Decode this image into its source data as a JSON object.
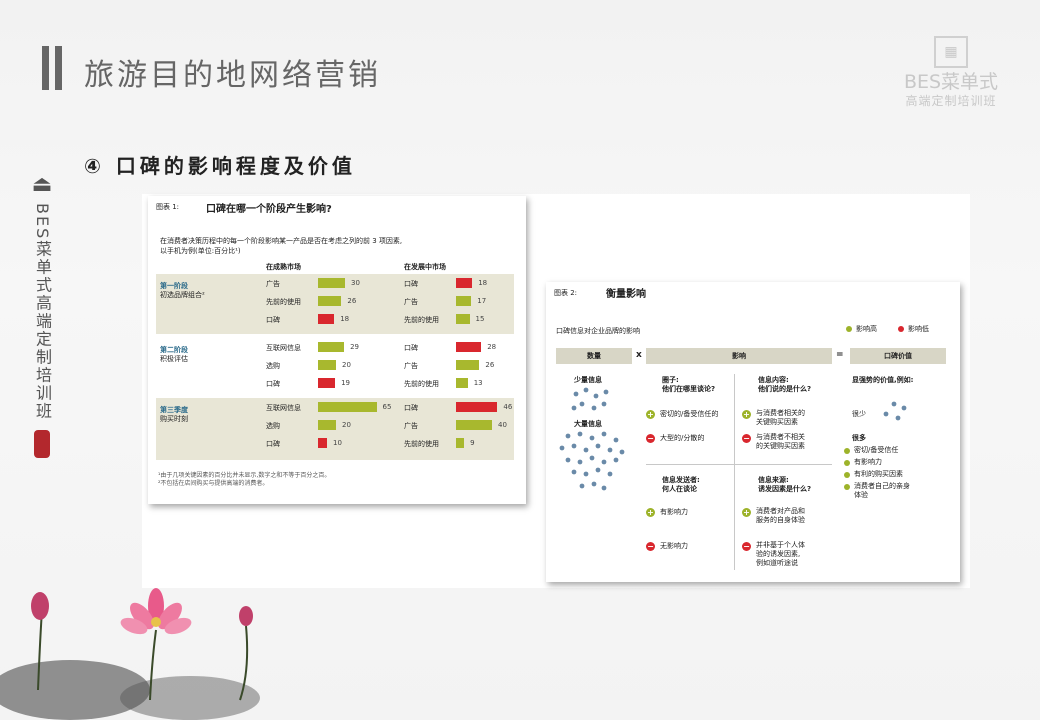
{
  "header": {
    "title": "旅游目的地网络营销",
    "subtitle": "④ 口碑的影响程度及价值"
  },
  "logo": {
    "line1": "BES菜单式",
    "line2": "高端定制培训班"
  },
  "side": {
    "text": "BES菜单式高端定制培训班"
  },
  "chart1": {
    "label": "图表 1:",
    "title": "口碑在哪一个阶段产生影响?",
    "desc1": "在消费者决策历程中的每一个阶段影响某一产品是否在考虑之列的前 3 项因素,",
    "desc2": "以手机为例(单位:百分比¹)",
    "col_mature": "在成熟市场",
    "col_developing": "在发展中市场",
    "footnote1": "¹由于几项关键因素的百分比并未显示,数字之和不等于百分之百。",
    "footnote2": "²不包括在店间购买与提供高端的消费者。"
  },
  "chart_data": {
    "type": "bar",
    "stages": [
      {
        "name": "第一阶段",
        "desc": "初选品牌组合²",
        "mature": [
          {
            "label": "广告",
            "value": 30
          },
          {
            "label": "先前的使用",
            "value": 26
          },
          {
            "label": "口碑",
            "value": 18
          }
        ],
        "developing": [
          {
            "label": "口碑",
            "value": 18
          },
          {
            "label": "广告",
            "value": 17
          },
          {
            "label": "先前的使用",
            "value": 15
          }
        ]
      },
      {
        "name": "第二阶段",
        "desc": "积极评估",
        "mature": [
          {
            "label": "互联网信息",
            "value": 29
          },
          {
            "label": "选购",
            "value": 20
          },
          {
            "label": "口碑",
            "value": 19
          }
        ],
        "developing": [
          {
            "label": "口碑",
            "value": 28
          },
          {
            "label": "广告",
            "value": 26
          },
          {
            "label": "先前的使用",
            "value": 13
          }
        ]
      },
      {
        "name": "第三季度",
        "desc": "购买时刻",
        "mature": [
          {
            "label": "互联网信息",
            "value": 65
          },
          {
            "label": "选购",
            "value": 20
          },
          {
            "label": "口碑",
            "value": 10
          }
        ],
        "developing": [
          {
            "label": "口碑",
            "value": 46
          },
          {
            "label": "广告",
            "value": 40
          },
          {
            "label": "先前的使用",
            "value": 9
          }
        ]
      }
    ],
    "colors": {
      "other": "#a8b82e",
      "word_of_mouth": "#d9272e"
    }
  },
  "chart2": {
    "label": "图表 2:",
    "title": "衡量影响",
    "subtitle": "口碑信息对企业品牌的影响",
    "legend_pos": "影响高",
    "legend_neg": "影响低",
    "h_qty": "数量",
    "op_x": "x",
    "h_impact": "影响",
    "op_eq": "=",
    "h_value": "口碑价值",
    "few": "少量信息",
    "many": "大量信息",
    "circle_q1": "圈子:",
    "circle_q2": "他们在哪里谈论?",
    "circle_p": "密切的/备受信任的",
    "circle_n": "大型的/分散的",
    "content_q1": "信息内容:",
    "content_q2": "他们说的是什么?",
    "content_p1": "与消费者相关的",
    "content_p2": "关键购买因素",
    "content_n1": "与消费者不相关",
    "content_n2": "的关键购买因素",
    "sender_q1": "信息发送者:",
    "sender_q2": "何人在谈论",
    "sender_p": "有影响力",
    "sender_n": "无影响力",
    "source_q1": "信息来源:",
    "source_q2": "诱发因素是什么?",
    "source_p1": "消费者对产品和",
    "source_p2": "服务的自身体验",
    "source_n1": "并非基于个人体",
    "source_n2": "验的诱发因素,",
    "source_n3": "例如道听途说",
    "value_q": "显强势的价值,例如:",
    "value_low": "很少",
    "value_high": "很多",
    "v1": "密切/备受信任",
    "v2": "有影响力",
    "v3": "有利的购买因素",
    "v4a": "消费者自己的亲身",
    "v4b": "体验",
    "colors": {
      "positive": "#9db32a",
      "negative": "#d9272e",
      "dots": "#6a8aa8"
    }
  }
}
